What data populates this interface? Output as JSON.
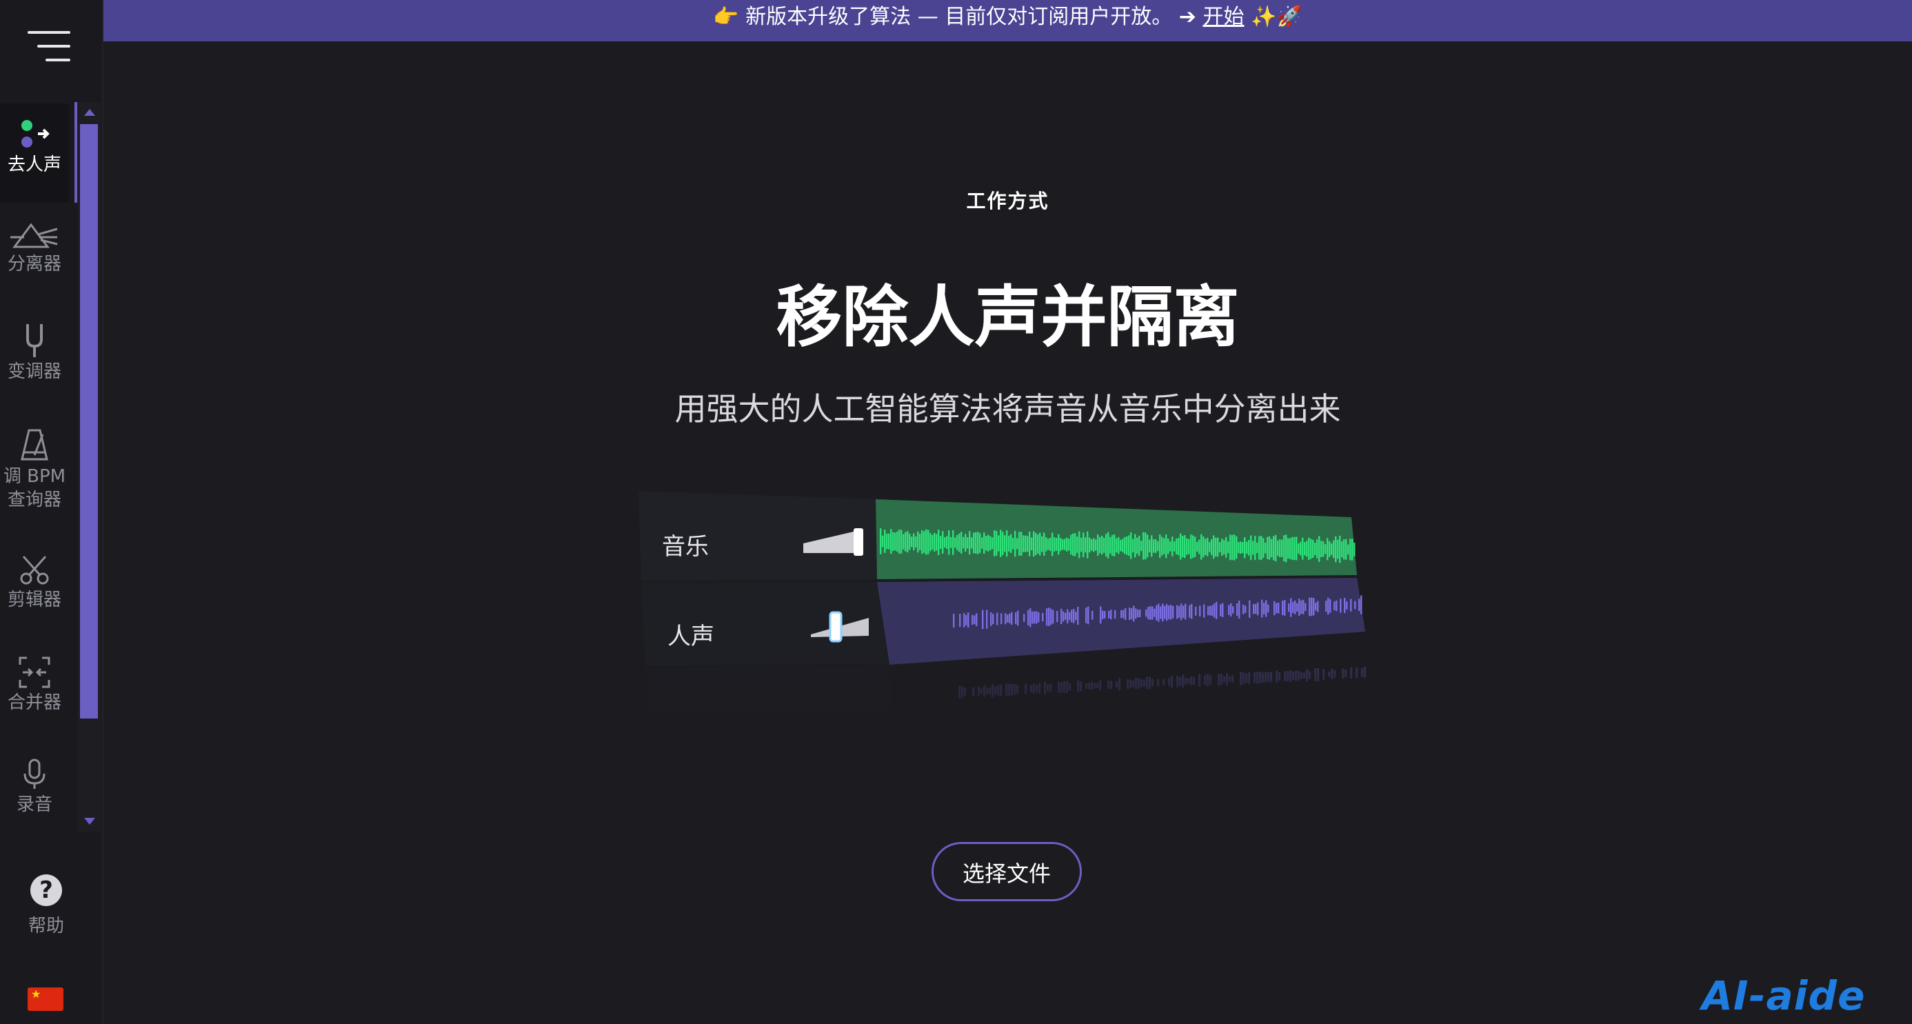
{
  "banner": {
    "emoji_left": "👉",
    "text": "新版本升级了算法 — 目前仅对订阅用户开放。 ➔ ",
    "link": "开始",
    "emoji_right": "✨🚀"
  },
  "sidebar": {
    "items": [
      {
        "label": "去人声",
        "icon": "vocal-remover-icon"
      },
      {
        "label": "分离器",
        "icon": "prism-icon"
      },
      {
        "label": "变调器",
        "icon": "tuning-fork-icon"
      },
      {
        "label_line1": "调 BPM",
        "label_line2": "查询器",
        "icon": "metronome-icon"
      },
      {
        "label": "剪辑器",
        "icon": "scissors-icon"
      },
      {
        "label": "合并器",
        "icon": "joiner-icon"
      },
      {
        "label": "录音",
        "icon": "microphone-icon"
      }
    ],
    "help_label": "帮助",
    "help_symbol": "?",
    "flag_star": "★"
  },
  "main": {
    "eyebrow": "工作方式",
    "title": "移除人声并隔离",
    "subtitle": "用强大的人工智能算法将声音从音乐中分离出来",
    "tracks": [
      {
        "label": "音乐",
        "color": "#2fe07a"
      },
      {
        "label": "人声",
        "color": "#7a6ee0"
      }
    ],
    "choose_button": "选择文件"
  },
  "watermark": "AI-aide",
  "colors": {
    "accent": "#6b5fc4",
    "banner": "#4a4493",
    "background": "#1b1b20",
    "music_wave": "#2fe07a",
    "vocal_wave": "#7a6ee0"
  }
}
